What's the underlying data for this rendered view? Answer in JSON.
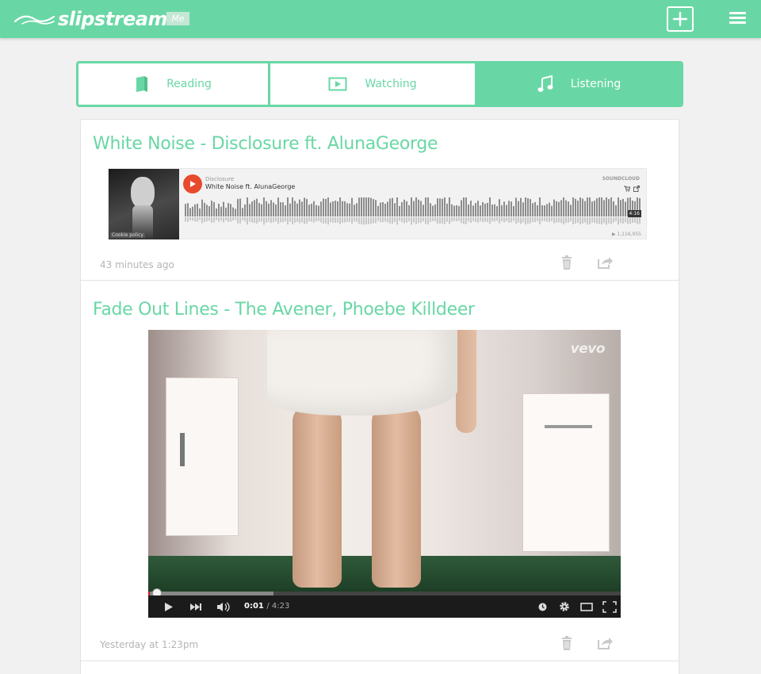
{
  "app": {
    "name": "slipstream",
    "me_label": "Me",
    "accent_color": "#69d7a5"
  },
  "header_icons": {
    "logo": "wave-icon",
    "add": "plus-icon",
    "menu": "hamburger-icon"
  },
  "tabs": [
    {
      "label": "Reading",
      "icon": "book-icon",
      "active": false
    },
    {
      "label": "Watching",
      "icon": "play-box-icon",
      "active": false
    },
    {
      "label": "Listening",
      "icon": "music-note-icon",
      "active": true
    }
  ],
  "feed": [
    {
      "title": "White Noise - Disclosure ft. AlunaGeorge",
      "time": "43 minutes ago",
      "embed": {
        "type": "soundcloud",
        "artist": "Disclosure",
        "track": "White Noise ft. AlunaGeorge",
        "brand": "SOUNDCLOUD",
        "duration": "4:16",
        "plays": "▶ 1,116,955",
        "art_caption": "Cookie policy"
      },
      "actions": [
        "trash-icon",
        "share-icon"
      ]
    },
    {
      "title": "Fade Out Lines - The Avener, Phoebe Killdeer",
      "time": "Yesterday at 1:23pm",
      "embed": {
        "type": "youtube",
        "watermark": "vevo",
        "current_time": "0:01",
        "duration": "/ 4:23",
        "progress_fraction": 0.004
      },
      "actions": [
        "trash-icon",
        "share-icon"
      ]
    }
  ]
}
